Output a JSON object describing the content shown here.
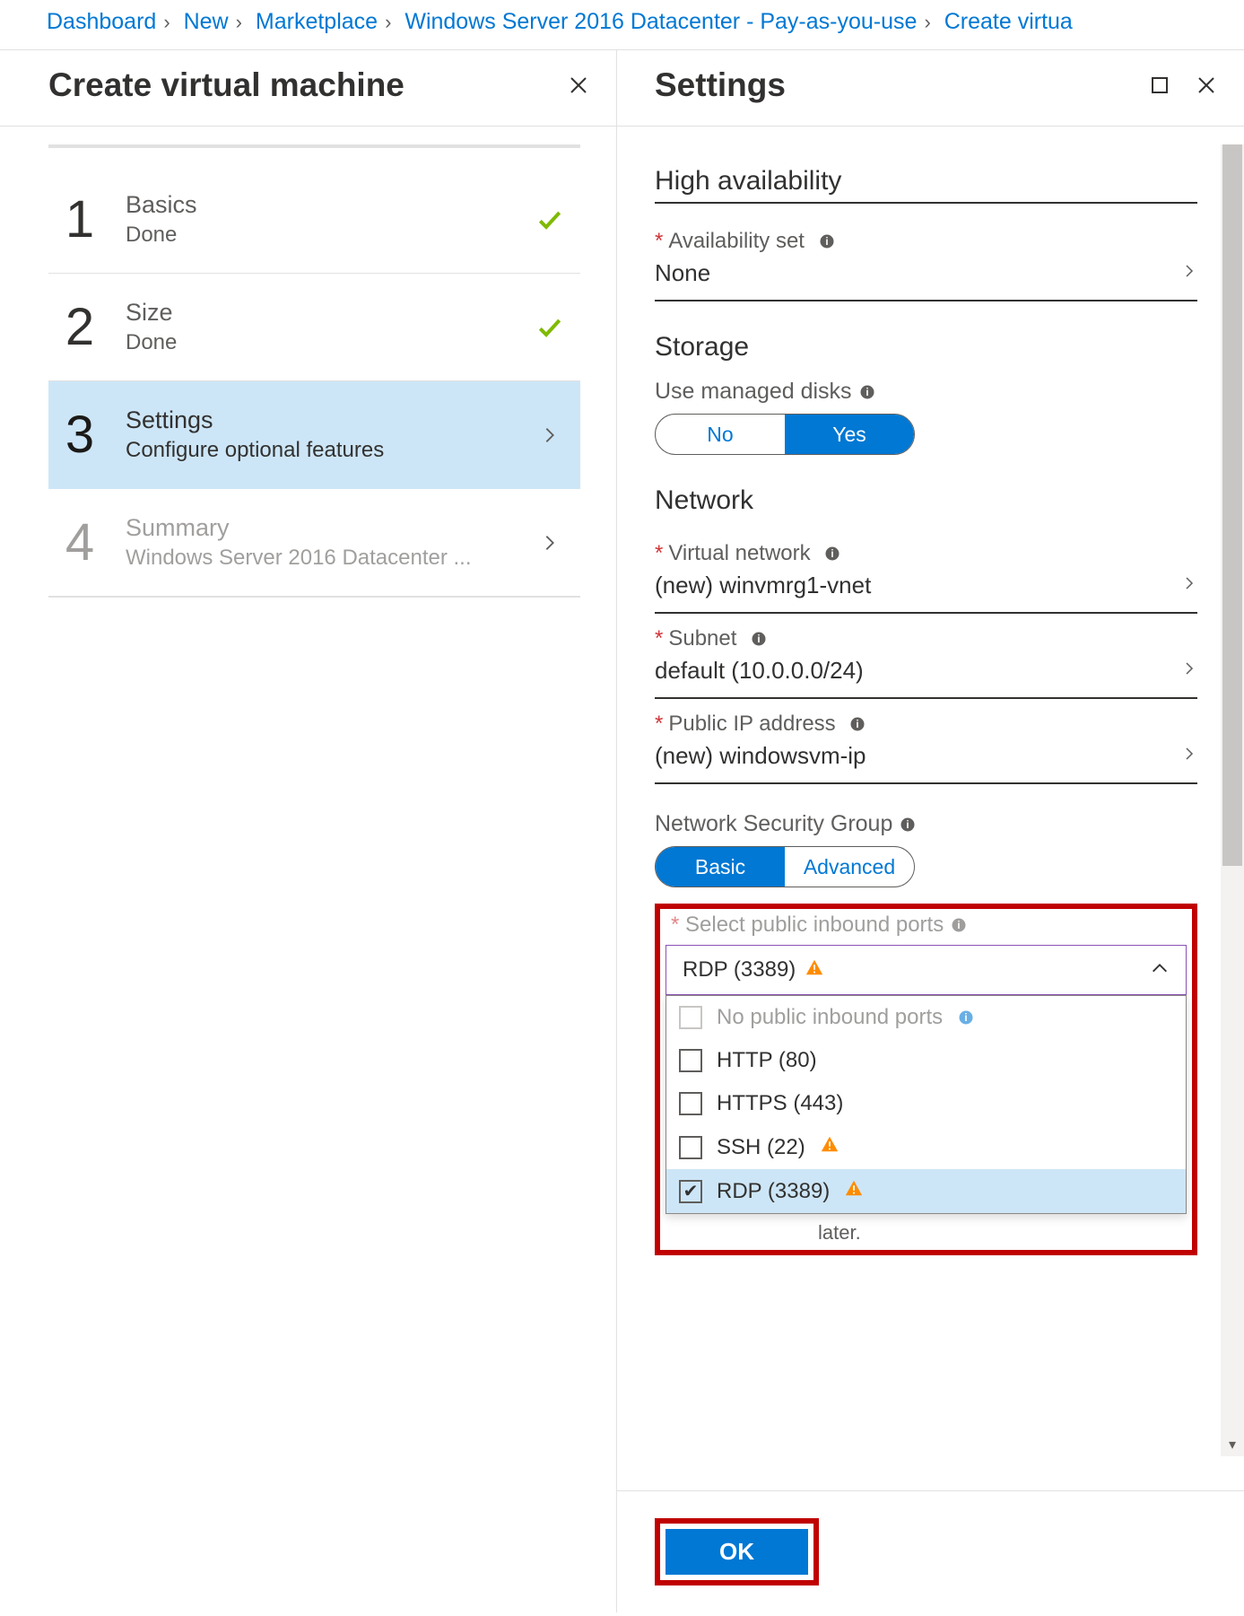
{
  "breadcrumbs": [
    "Dashboard",
    "New",
    "Marketplace",
    "Windows Server 2016 Datacenter - Pay-as-you-use",
    "Create virtua"
  ],
  "left_panel": {
    "title": "Create virtual machine",
    "steps": [
      {
        "num": "1",
        "title": "Basics",
        "sub": "Done",
        "status": "done"
      },
      {
        "num": "2",
        "title": "Size",
        "sub": "Done",
        "status": "done"
      },
      {
        "num": "3",
        "title": "Settings",
        "sub": "Configure optional features",
        "status": "active"
      },
      {
        "num": "4",
        "title": "Summary",
        "sub": "Windows Server 2016 Datacenter ...",
        "status": "disabled"
      }
    ]
  },
  "right_panel": {
    "title": "Settings",
    "high_availability": {
      "header": "High availability",
      "avail_label": "Availability set",
      "avail_value": "None"
    },
    "storage": {
      "header": "Storage",
      "managed_label": "Use managed disks",
      "no_label": "No",
      "yes_label": "Yes"
    },
    "network": {
      "header": "Network",
      "vnet_label": "Virtual network",
      "vnet_value": "(new) winvmrg1-vnet",
      "subnet_label": "Subnet",
      "subnet_value": "default (10.0.0.0/24)",
      "pip_label": "Public IP address",
      "pip_value": "(new) windowsvm-ip",
      "nsg_label": "Network Security Group",
      "nsg_basic": "Basic",
      "nsg_adv": "Advanced",
      "ports_label": "Select public inbound ports",
      "ports_selected": "RDP (3389)",
      "ports_options": [
        {
          "label": "No public inbound ports",
          "checked": false,
          "disabled": true,
          "warn": false,
          "info": true
        },
        {
          "label": "HTTP (80)",
          "checked": false,
          "disabled": false,
          "warn": false,
          "info": false
        },
        {
          "label": "HTTPS (443)",
          "checked": false,
          "disabled": false,
          "warn": false,
          "info": false
        },
        {
          "label": "SSH (22)",
          "checked": false,
          "disabled": false,
          "warn": true,
          "info": false
        },
        {
          "label": "RDP (3389)",
          "checked": true,
          "disabled": false,
          "warn": true,
          "info": false
        }
      ],
      "trailing_note": "later."
    },
    "ok_label": "OK"
  }
}
